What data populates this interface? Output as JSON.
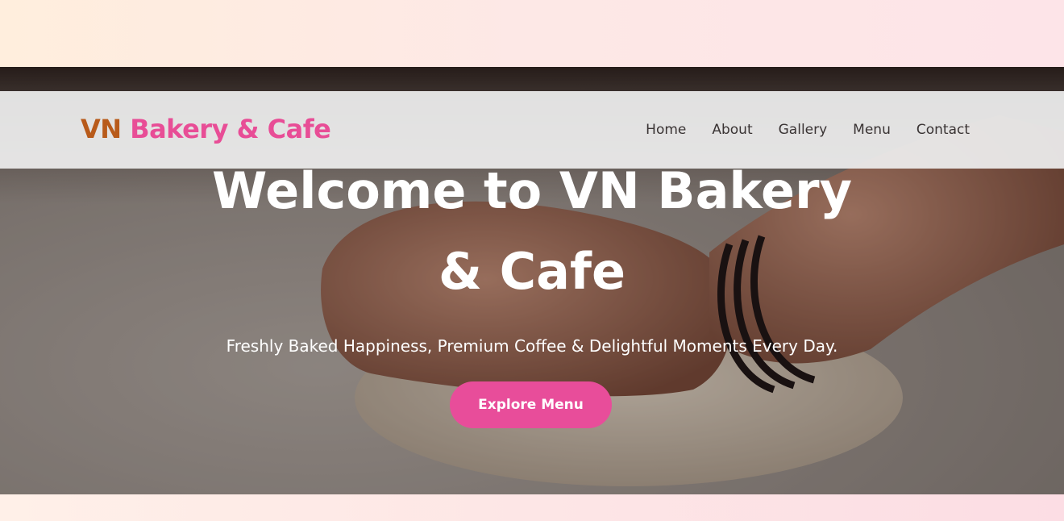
{
  "brand": {
    "prefix": "VN",
    "name": "Bakery & Cafe",
    "prefix_color": "#b85a1a",
    "accent": "#e84d96"
  },
  "nav": {
    "items": [
      {
        "label": "Home"
      },
      {
        "label": "About"
      },
      {
        "label": "Gallery"
      },
      {
        "label": "Menu"
      },
      {
        "label": "Contact"
      }
    ]
  },
  "hero": {
    "title_line1": "Welcome to VN Bakery",
    "title_line2": "& Cafe",
    "subtitle": "Freshly Baked Happiness, Premium Coffee & Delightful Moments Every Day.",
    "cta_label": "Explore Menu",
    "image_alt": "hands-kneading-dough-photo"
  }
}
